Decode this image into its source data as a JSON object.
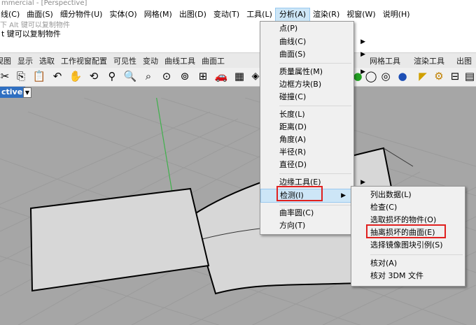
{
  "window": {
    "title": "mmercial - [Perspective]"
  },
  "menubar": [
    {
      "label": "线(C)"
    },
    {
      "label": "曲面(S)"
    },
    {
      "label": "细分物件(U)"
    },
    {
      "label": "实体(O)"
    },
    {
      "label": "网格(M)"
    },
    {
      "label": "出图(D)"
    },
    {
      "label": "变动(T)"
    },
    {
      "label": "工具(L)"
    },
    {
      "label": "分析(A)",
      "active": true
    },
    {
      "label": "渲染(R)"
    },
    {
      "label": "视窗(W)"
    },
    {
      "label": "说明(H)"
    }
  ],
  "command": {
    "prev": "下 Alt 键可以复制物件",
    "current": "t 键可以复制物件"
  },
  "tabs": [
    "视图",
    "显示",
    "选取",
    "工作视窗配置",
    "可见性",
    "变动",
    "曲线工具",
    "曲面工",
    "",
    "",
    "",
    "",
    "网格工具",
    "渲染工具",
    "出图"
  ],
  "viewport": {
    "label": "ctive",
    "dropdown": "▼"
  },
  "analyze_menu": [
    {
      "label": "点(P)"
    },
    {
      "label": "曲线(C)",
      "submenu": true
    },
    {
      "label": "曲面(S)",
      "submenu": true
    },
    {
      "label": "质量属性(M)",
      "submenu": true
    },
    {
      "label": "边框方块(B)"
    },
    {
      "label": "碰撞(C)"
    },
    {
      "label": "长度(L)"
    },
    {
      "label": "距离(D)"
    },
    {
      "label": "角度(A)"
    },
    {
      "label": "半径(R)"
    },
    {
      "label": "直径(D)"
    },
    {
      "label": "边缘工具(E)",
      "submenu": true
    },
    {
      "label": "检测(I)",
      "submenu": true,
      "highlighted": true
    },
    {
      "label": "曲率圆(C)"
    },
    {
      "label": "方向(T)"
    }
  ],
  "inspect_submenu": [
    {
      "label": "列出数据(L)"
    },
    {
      "label": "检查(C)"
    },
    {
      "label": "选取损坏的物件(O)"
    },
    {
      "label": "抽离损坏的曲面(E)",
      "boxed": true
    },
    {
      "label": "选择镜像图块引例(S)"
    },
    {
      "label": "核对(A)"
    },
    {
      "label": "核对 3DM 文件"
    }
  ],
  "colors": {
    "highlight": "#cde6f7",
    "annotation": "#e0201f",
    "viewport_tab": "#2f6fc1",
    "viewport_bg": "#a6a6a6"
  },
  "icons": [
    "scissors-icon",
    "copy-icon",
    "clipboard-icon",
    "undo-icon",
    "pan-hand-icon",
    "rotate-view-icon",
    "zoom-icon",
    "zoom-extents-icon",
    "zoom-selected-icon",
    "zoom-window-icon",
    "four-views-icon",
    "car-icon",
    "grid-icon",
    "sphere-icon",
    "render-sphere-icon",
    "settings-gear-icon"
  ]
}
